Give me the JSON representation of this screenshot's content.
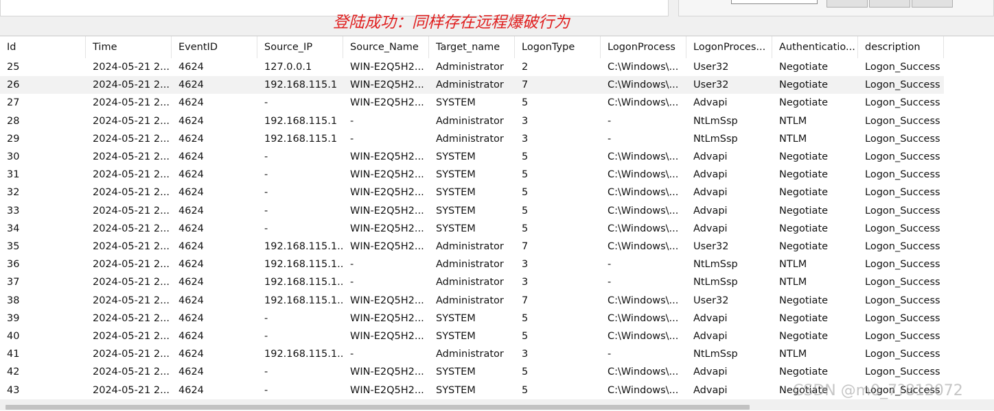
{
  "annotation": "登陆成功：同样存在远程爆破行为",
  "watermark": "CSDN @m0_7?812072",
  "table": {
    "columns": [
      "Id",
      "Time",
      "EventID",
      "Source_IP",
      "Source_Name",
      "Target_name",
      "LogonType",
      "LogonProcess",
      "LogonProces...",
      "Authenticatio...",
      "description"
    ],
    "rows": [
      [
        "25",
        "2024-05-21 2...",
        "4624",
        "127.0.0.1",
        "WIN-E2Q5H2...",
        "Administrator",
        "2",
        "C:\\Windows\\...",
        "User32",
        "Negotiate",
        "Logon_Success"
      ],
      [
        "26",
        "2024-05-21 2...",
        "4624",
        "192.168.115.1",
        "WIN-E2Q5H2...",
        "Administrator",
        "7",
        "C:\\Windows\\...",
        "User32",
        "Negotiate",
        "Logon_Success"
      ],
      [
        "27",
        "2024-05-21 2...",
        "4624",
        "-",
        "WIN-E2Q5H2...",
        "SYSTEM",
        "5",
        "C:\\Windows\\...",
        "Advapi",
        "Negotiate",
        "Logon_Success"
      ],
      [
        "28",
        "2024-05-21 2...",
        "4624",
        "192.168.115.1",
        "-",
        "Administrator",
        "3",
        "-",
        "NtLmSsp",
        "NTLM",
        "Logon_Success"
      ],
      [
        "29",
        "2024-05-21 2...",
        "4624",
        "192.168.115.1",
        "-",
        "Administrator",
        "3",
        "-",
        "NtLmSsp",
        "NTLM",
        "Logon_Success"
      ],
      [
        "30",
        "2024-05-21 2...",
        "4624",
        "-",
        "WIN-E2Q5H2...",
        "SYSTEM",
        "5",
        "C:\\Windows\\...",
        "Advapi",
        "Negotiate",
        "Logon_Success"
      ],
      [
        "31",
        "2024-05-21 2...",
        "4624",
        "-",
        "WIN-E2Q5H2...",
        "SYSTEM",
        "5",
        "C:\\Windows\\...",
        "Advapi",
        "Negotiate",
        "Logon_Success"
      ],
      [
        "32",
        "2024-05-21 2...",
        "4624",
        "-",
        "WIN-E2Q5H2...",
        "SYSTEM",
        "5",
        "C:\\Windows\\...",
        "Advapi",
        "Negotiate",
        "Logon_Success"
      ],
      [
        "33",
        "2024-05-21 2...",
        "4624",
        "-",
        "WIN-E2Q5H2...",
        "SYSTEM",
        "5",
        "C:\\Windows\\...",
        "Advapi",
        "Negotiate",
        "Logon_Success"
      ],
      [
        "34",
        "2024-05-21 2...",
        "4624",
        "-",
        "WIN-E2Q5H2...",
        "SYSTEM",
        "5",
        "C:\\Windows\\...",
        "Advapi",
        "Negotiate",
        "Logon_Success"
      ],
      [
        "35",
        "2024-05-21 2...",
        "4624",
        "192.168.115.1...",
        "WIN-E2Q5H2...",
        "Administrator",
        "7",
        "C:\\Windows\\...",
        "User32",
        "Negotiate",
        "Logon_Success"
      ],
      [
        "36",
        "2024-05-21 2...",
        "4624",
        "192.168.115.1...",
        "-",
        "Administrator",
        "3",
        "-",
        "NtLmSsp",
        "NTLM",
        "Logon_Success"
      ],
      [
        "37",
        "2024-05-21 2...",
        "4624",
        "192.168.115.1...",
        "-",
        "Administrator",
        "3",
        "-",
        "NtLmSsp",
        "NTLM",
        "Logon_Success"
      ],
      [
        "38",
        "2024-05-21 2...",
        "4624",
        "192.168.115.1...",
        "WIN-E2Q5H2...",
        "Administrator",
        "7",
        "C:\\Windows\\...",
        "User32",
        "Negotiate",
        "Logon_Success"
      ],
      [
        "39",
        "2024-05-21 2...",
        "4624",
        "-",
        "WIN-E2Q5H2...",
        "SYSTEM",
        "5",
        "C:\\Windows\\...",
        "Advapi",
        "Negotiate",
        "Logon_Success"
      ],
      [
        "40",
        "2024-05-21 2...",
        "4624",
        "-",
        "WIN-E2Q5H2...",
        "SYSTEM",
        "5",
        "C:\\Windows\\...",
        "Advapi",
        "Negotiate",
        "Logon_Success"
      ],
      [
        "41",
        "2024-05-21 2...",
        "4624",
        "192.168.115.1...",
        "-",
        "Administrator",
        "3",
        "-",
        "NtLmSsp",
        "NTLM",
        "Logon_Success"
      ],
      [
        "42",
        "2024-05-21 2...",
        "4624",
        "-",
        "WIN-E2Q5H2...",
        "SYSTEM",
        "5",
        "C:\\Windows\\...",
        "Advapi",
        "Negotiate",
        "Logon_Success"
      ],
      [
        "43",
        "2024-05-21 2...",
        "4624",
        "-",
        "WIN-E2Q5H2...",
        "SYSTEM",
        "5",
        "C:\\Windows\\...",
        "Advapi",
        "Negotiate",
        "Logon_Success"
      ]
    ],
    "selected_row_index": 1
  },
  "colors": {
    "annotation": "#e02020",
    "selected_row": "#f2f2f2",
    "grid_background": "#ffffff"
  }
}
